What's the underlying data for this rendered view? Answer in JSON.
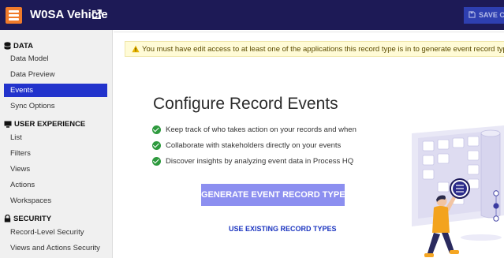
{
  "header": {
    "title": "W0SA Vehicle",
    "save_label": "SAVE CHA",
    "app_icon": "record-type-icon",
    "edit_icon": "external-edit-icon",
    "colors": {
      "background": "#1d1a56",
      "app_icon": "#f07b2b",
      "save_button": "#2e3fb0"
    }
  },
  "sidebar": {
    "active_color": "#2233cc",
    "sections": [
      {
        "label": "DATA",
        "icon": "database-icon",
        "items": [
          "Data Model",
          "Data Preview",
          "Events",
          "Sync Options"
        ]
      },
      {
        "label": "USER EXPERIENCE",
        "icon": "monitor-icon",
        "items": [
          "List",
          "Filters",
          "Views",
          "Actions",
          "Workspaces"
        ]
      },
      {
        "label": "SECURITY",
        "icon": "lock-icon",
        "items": [
          "Record-Level Security",
          "Views and Actions Security"
        ]
      }
    ],
    "active_item": "Events"
  },
  "main": {
    "alert": {
      "icon": "warning-icon",
      "text": "You must have edit access to at least one of the applications this record type is in to generate event record types"
    },
    "title": "Configure Record Events",
    "features": [
      "Keep track of who takes action on your records and when",
      "Collaborate with stakeholders directly on your events",
      "Discover insights by analyzing event data in Process HQ"
    ],
    "feature_icon": "check-circle-icon",
    "generate_button": "GENERATE EVENT RECORD TYPES",
    "use_existing_link": "USE EXISTING RECORD TYPES",
    "illustration": "person-with-data-screens-illustration",
    "colors": {
      "check": "#2e9a3e",
      "generate_button": "#8c8ff0",
      "link": "#1c35c0",
      "alert_bg": "#fffbd6"
    }
  }
}
